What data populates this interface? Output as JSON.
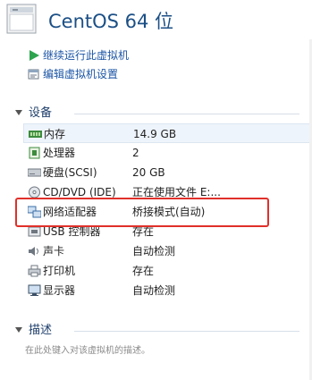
{
  "window": {
    "title": "CentOS 64 位"
  },
  "actions": [
    {
      "label": "继续运行此虚拟机",
      "icon": "play-icon"
    },
    {
      "label": "编辑虚拟机设置",
      "icon": "edit-settings-icon"
    }
  ],
  "devices_section": {
    "label": "设备"
  },
  "devices": [
    {
      "name": "内存",
      "value": "14.9 GB",
      "icon": "memory-icon"
    },
    {
      "name": "处理器",
      "value": "2",
      "icon": "processor-icon"
    },
    {
      "name": "硬盘(SCSI)",
      "value": "20 GB",
      "icon": "hard-disk-icon"
    },
    {
      "name": "CD/DVD (IDE)",
      "value": "正在使用文件 E:...",
      "icon": "cd-dvd-icon"
    },
    {
      "name": "网络适配器",
      "value": "桥接模式(自动)",
      "icon": "network-adapter-icon"
    },
    {
      "name": "USB 控制器",
      "value": "存在",
      "icon": "usb-icon"
    },
    {
      "name": "声卡",
      "value": "自动检测",
      "icon": "sound-card-icon"
    },
    {
      "name": "打印机",
      "value": "存在",
      "icon": "printer-icon"
    },
    {
      "name": "显示器",
      "value": "自动检测",
      "icon": "display-icon"
    }
  ],
  "description_section": {
    "label": "描述"
  },
  "description": {
    "placeholder": "在此处键入对该虚拟机的描述。"
  },
  "colors": {
    "highlight": "#e0302a",
    "title": "#1b4f86",
    "link": "#1b55a5"
  }
}
